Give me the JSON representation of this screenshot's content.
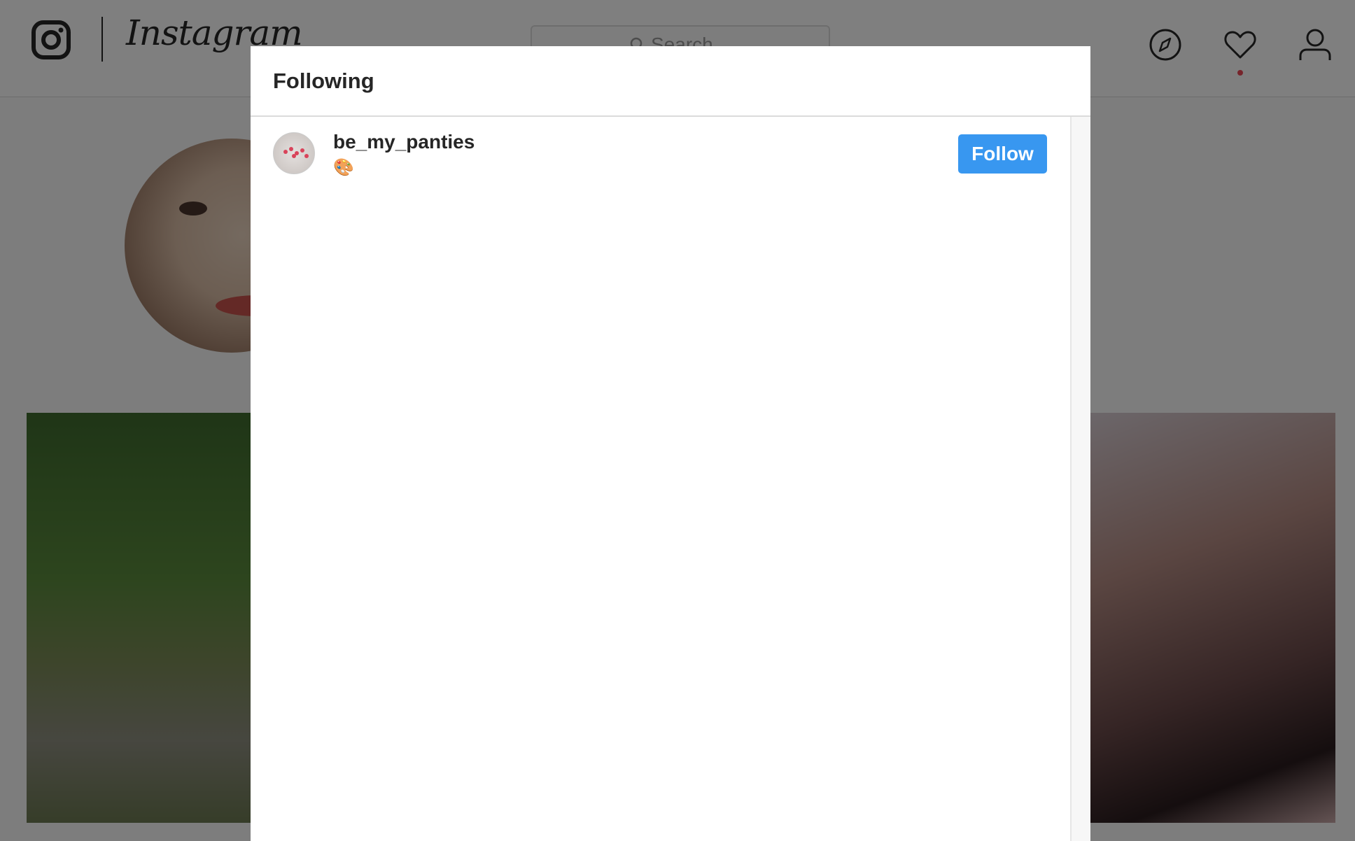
{
  "nav": {
    "logo_glyph": "instagram-glyph-icon",
    "logo_text": "Instagram",
    "search": {
      "placeholder": "Search",
      "icon": "search-icon"
    },
    "icons": [
      "compass-icon",
      "heart-icon",
      "user-icon"
    ],
    "notification_dot_color": "#ed4956"
  },
  "modal": {
    "title": "Following",
    "users": [
      {
        "username": "be_my_panties",
        "subtitle": "🎨",
        "action": "Follow"
      }
    ]
  },
  "colors": {
    "follow_button": "#3897f0",
    "overlay": "rgba(0,0,0,0.5)"
  }
}
